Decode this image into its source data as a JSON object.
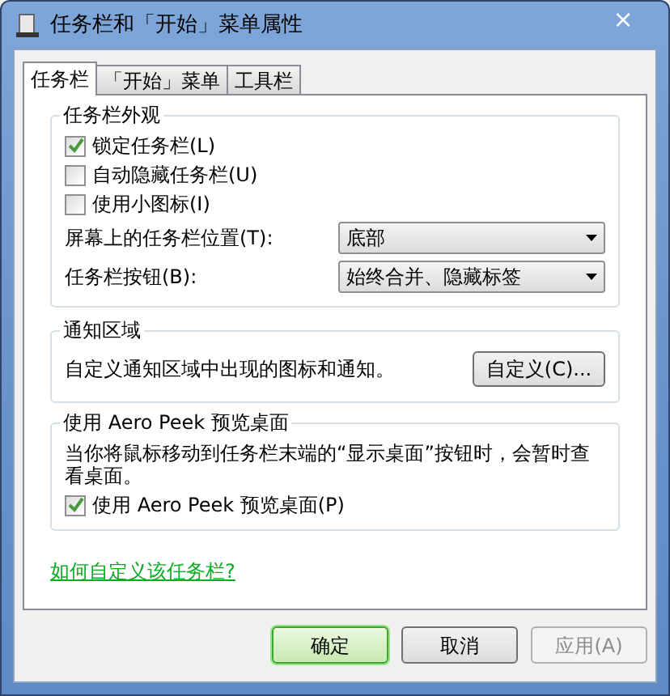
{
  "window": {
    "title": "任务栏和「开始」菜单属性",
    "close": "×"
  },
  "tabs": [
    {
      "label": "任务栏",
      "selected": true
    },
    {
      "label": "「开始」菜单",
      "selected": false
    },
    {
      "label": "工具栏",
      "selected": false
    }
  ],
  "appearance": {
    "title": "任务栏外观",
    "checkboxes": [
      {
        "label": "锁定任务栏(L)",
        "checked": true
      },
      {
        "label": "自动隐藏任务栏(U)",
        "checked": false
      },
      {
        "label": "使用小图标(I)",
        "checked": false
      }
    ],
    "dropdowns": [
      {
        "label": "屏幕上的任务栏位置(T):",
        "value": "底部"
      },
      {
        "label": "任务栏按钮(B):",
        "value": "始终合并、隐藏标签"
      }
    ]
  },
  "notification": {
    "title": "通知区域",
    "text": "自定义通知区域中出现的图标和通知。",
    "button": "自定义(C)..."
  },
  "aero_peek": {
    "title": "使用 Aero Peek 预览桌面",
    "text": "当你将鼠标移动到任务栏末端的“显示桌面”按钮时，会暂时查看桌面。",
    "checkbox": {
      "label": "使用 Aero Peek 预览桌面(P)",
      "checked": true
    }
  },
  "help_link": "如何自定义该任务栏?",
  "buttons": [
    {
      "label": "确定",
      "default": true,
      "disabled": false
    },
    {
      "label": "取消",
      "default": false,
      "disabled": false
    },
    {
      "label": "应用(A)",
      "default": false,
      "disabled": true
    }
  ]
}
